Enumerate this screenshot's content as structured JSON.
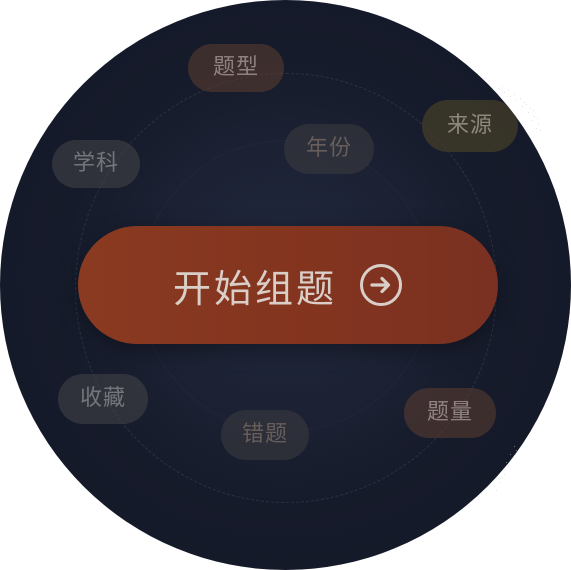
{
  "start_button": {
    "label": "开始组题",
    "icon": "arrow-right-circle-icon"
  },
  "filters": {
    "question_type": "题型",
    "source": "来源",
    "subject": "学科",
    "year": "年份",
    "favorites": "收藏",
    "wrong_questions": "错题",
    "question_count": "题量"
  },
  "colors": {
    "background": "#171c2c",
    "button": "#83341f",
    "button_text": "#d9cfc8"
  }
}
